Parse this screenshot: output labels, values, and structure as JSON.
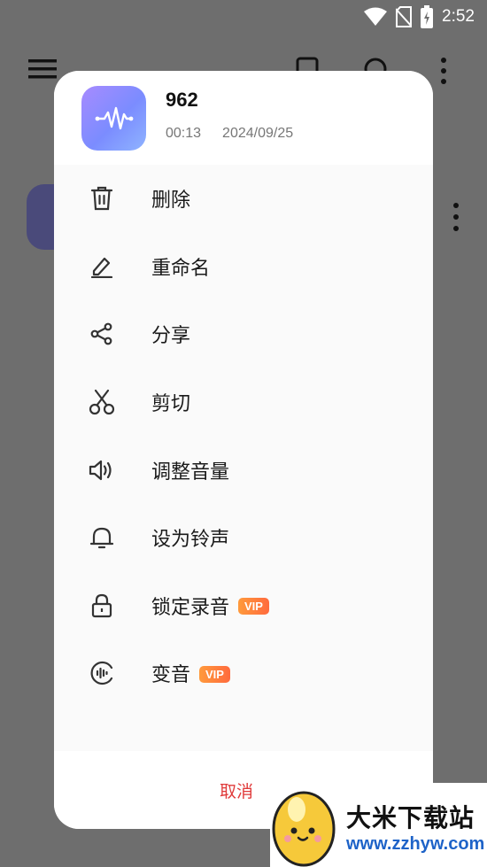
{
  "status_bar": {
    "time": "2:52"
  },
  "sheet": {
    "file_name": "962",
    "duration": "00:13",
    "date": "2024/09/25",
    "menu": [
      {
        "id": "delete",
        "label": "删除",
        "icon": "trash-icon"
      },
      {
        "id": "rename",
        "label": "重命名",
        "icon": "pencil-icon"
      },
      {
        "id": "share",
        "label": "分享",
        "icon": "share-icon"
      },
      {
        "id": "cut",
        "label": "剪切",
        "icon": "scissors-icon"
      },
      {
        "id": "volume",
        "label": "调整音量",
        "icon": "speaker-icon"
      },
      {
        "id": "ringtone",
        "label": "设为铃声",
        "icon": "bell-icon"
      },
      {
        "id": "lock",
        "label": "锁定录音",
        "icon": "lock-icon",
        "badge": "VIP"
      },
      {
        "id": "voice-change",
        "label": "变音",
        "icon": "voice-wave-icon",
        "badge": "VIP"
      }
    ],
    "cancel_label": "取消"
  },
  "watermark": {
    "title": "大米下载站",
    "url": "www.zzhyw.com"
  },
  "colors": {
    "accent_red": "#e03a3a",
    "vip_badge": "#ff7a3c",
    "logo_gradient_start": "#a78bff",
    "logo_gradient_end": "#8fb4ff"
  }
}
